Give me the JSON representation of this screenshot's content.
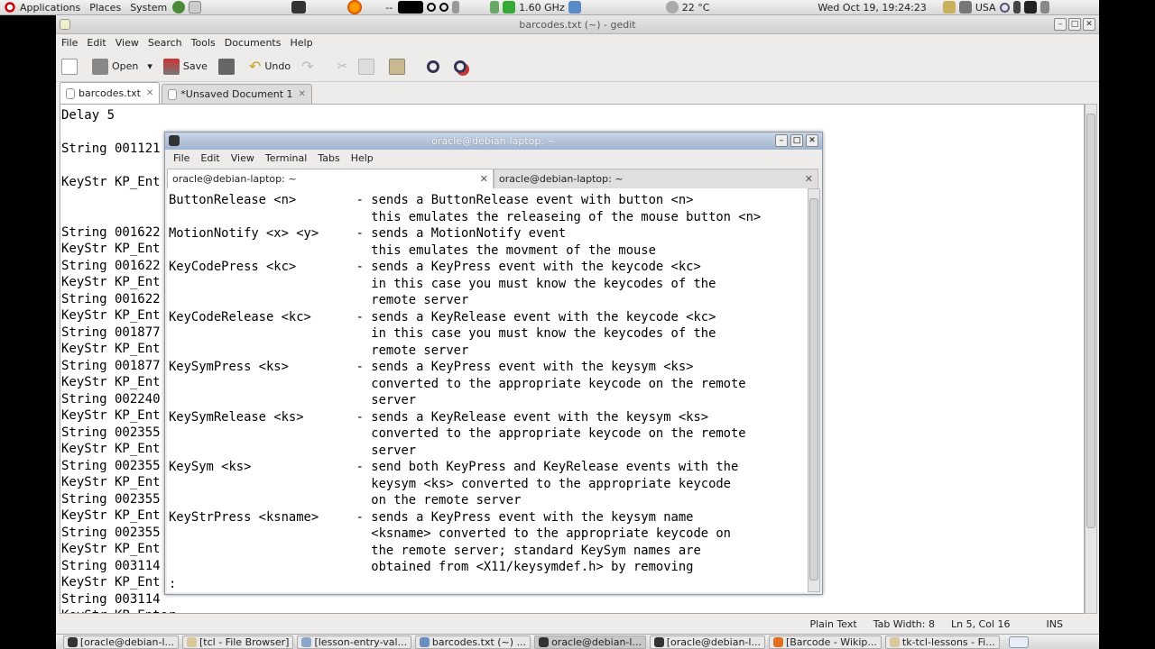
{
  "top_panel": {
    "applications": "Applications",
    "places": "Places",
    "system": "System",
    "cpu": "1.60 GHz",
    "temp": "22 °C",
    "clock": "Wed Oct 19, 19:24:23",
    "keyboard": "USA",
    "sep": "--"
  },
  "gedit": {
    "title": "barcodes.txt (~) - gedit",
    "menu": [
      "File",
      "Edit",
      "View",
      "Search",
      "Tools",
      "Documents",
      "Help"
    ],
    "toolbar": {
      "open": "Open",
      "save": "Save",
      "undo": "Undo"
    },
    "tabs": [
      {
        "label": "barcodes.txt"
      },
      {
        "label": "*Unsaved Document 1"
      }
    ],
    "editor_text": "Delay 5\n\nString 001121\n\nKeyStr KP_Ent\n\n\nString 001622\nKeyStr KP_Ent\nString 001622\nKeyStr KP_Ent\nString 001622\nKeyStr KP_Ent\nString 001877\nKeyStr KP_Ent\nString 001877\nKeyStr KP_Ent\nString 002240\nKeyStr KP_Ent\nString 002355\nKeyStr KP_Ent\nString 002355\nKeyStr KP_Ent\nString 002355\nKeyStr KP_Ent\nString 002355\nKeyStr KP_Ent\nString 003114\nKeyStr KP_Ent\nString 003114\nKeyStr KP_Enter",
    "status": {
      "mode": "Plain Text",
      "tab": "Tab Width: 8",
      "pos": "Ln 5, Col 16",
      "ins": "INS"
    }
  },
  "terminal": {
    "title": "oracle@debian-laptop: ~",
    "menu": [
      "File",
      "Edit",
      "View",
      "Terminal",
      "Tabs",
      "Help"
    ],
    "tabs": [
      {
        "label": "oracle@debian-laptop: ~"
      },
      {
        "label": "oracle@debian-laptop: ~"
      }
    ],
    "text": "ButtonRelease <n>        - sends a ButtonRelease event with button <n>\n                           this emulates the releaseing of the mouse button <n>\nMotionNotify <x> <y>     - sends a MotionNotify event\n                           this emulates the movment of the mouse\nKeyCodePress <kc>        - sends a KeyPress event with the keycode <kc>\n                           in this case you must know the keycodes of the\n                           remote server\nKeyCodeRelease <kc>      - sends a KeyRelease event with the keycode <kc>\n                           in this case you must know the keycodes of the\n                           remote server\nKeySymPress <ks>         - sends a KeyPress event with the keysym <ks>\n                           converted to the appropriate keycode on the remote\n                           server\nKeySymRelease <ks>       - sends a KeyRelease event with the keysym <ks>\n                           converted to the appropriate keycode on the remote\n                           server\nKeySym <ks>              - send both KeyPress and KeyRelease events with the\n                           keysym <ks> converted to the appropriate keycode\n                           on the remote server\nKeyStrPress <ksname>     - sends a KeyPress event with the keysym name\n                           <ksname> converted to the appropriate keycode on\n                           the remote server; standard KeySym names are\n                           obtained from <X11/keysymdef.h> by removing\n:"
  },
  "taskbar": [
    {
      "label": "[oracle@debian-l...",
      "color": "#333"
    },
    {
      "label": "[tcl - File Browser]",
      "color": "#d8c89a"
    },
    {
      "label": "[lesson-entry-val...",
      "color": "#8aa6c8"
    },
    {
      "label": "barcodes.txt (~) ...",
      "color": "#6a8fbf"
    },
    {
      "label": "oracle@debian-l...",
      "color": "#333"
    },
    {
      "label": "[oracle@debian-l...",
      "color": "#333"
    },
    {
      "label": "[Barcode - Wikip...",
      "color": "#e07020"
    },
    {
      "label": "tk-tcl-lessons - Fi...",
      "color": "#d8c89a"
    }
  ],
  "icons": {
    "debian": "debian-swirl-icon",
    "firefox": "firefox-icon"
  }
}
